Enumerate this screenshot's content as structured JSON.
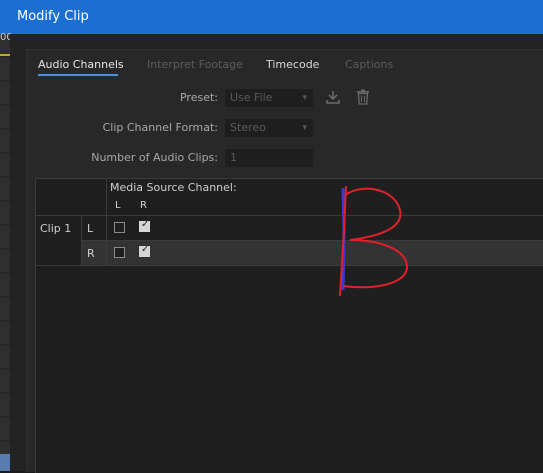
{
  "window": {
    "title": "Modify Clip"
  },
  "background": {
    "left_label": "00"
  },
  "tabs": [
    {
      "label": "Audio Channels",
      "state": "active"
    },
    {
      "label": "Interpret Footage",
      "state": "disabled"
    },
    {
      "label": "Timecode",
      "state": "normal"
    },
    {
      "label": "Captions",
      "state": "disabled"
    }
  ],
  "form": {
    "preset_label": "Preset:",
    "preset_value": "Use File",
    "channel_format_label": "Clip Channel Format:",
    "channel_format_value": "Stereo",
    "num_clips_label": "Number of Audio Clips:",
    "num_clips_value": "1"
  },
  "icons": {
    "import": "download-icon",
    "delete": "trash-icon"
  },
  "matrix": {
    "header": "Media Source Channel:",
    "columns": [
      "L",
      "R"
    ],
    "clip_label": "Clip 1",
    "rows": [
      {
        "channel": "L",
        "checks": [
          false,
          true
        ]
      },
      {
        "channel": "R",
        "checks": [
          false,
          true
        ]
      }
    ]
  },
  "annotation": {
    "color": "#e0202a",
    "letter": "B"
  },
  "colors": {
    "titlebar": "#1c6fd0",
    "accent": "#4a90e2"
  }
}
